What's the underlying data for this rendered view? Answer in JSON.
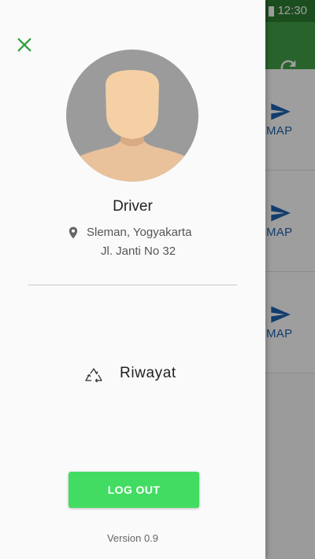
{
  "status_bar": {
    "time": "12:30"
  },
  "background_list": {
    "items": [
      {
        "map_label": "MAP"
      },
      {
        "map_label": "MAP"
      },
      {
        "map_label": "MAP"
      }
    ]
  },
  "drawer": {
    "profile": {
      "name": "Driver",
      "location_city": "Sleman, Yogyakarta",
      "location_street": "Jl. Janti No 32"
    },
    "menu": [
      {
        "label": "Riwayat",
        "icon": "recycle-icon"
      }
    ],
    "logout_label": "LOG OUT",
    "version": "Version 0.9"
  },
  "colors": {
    "primary_green": "#43a047",
    "logout_green": "#43dc63",
    "map_blue": "#1e63b0",
    "close_green": "#2e9e3a"
  }
}
